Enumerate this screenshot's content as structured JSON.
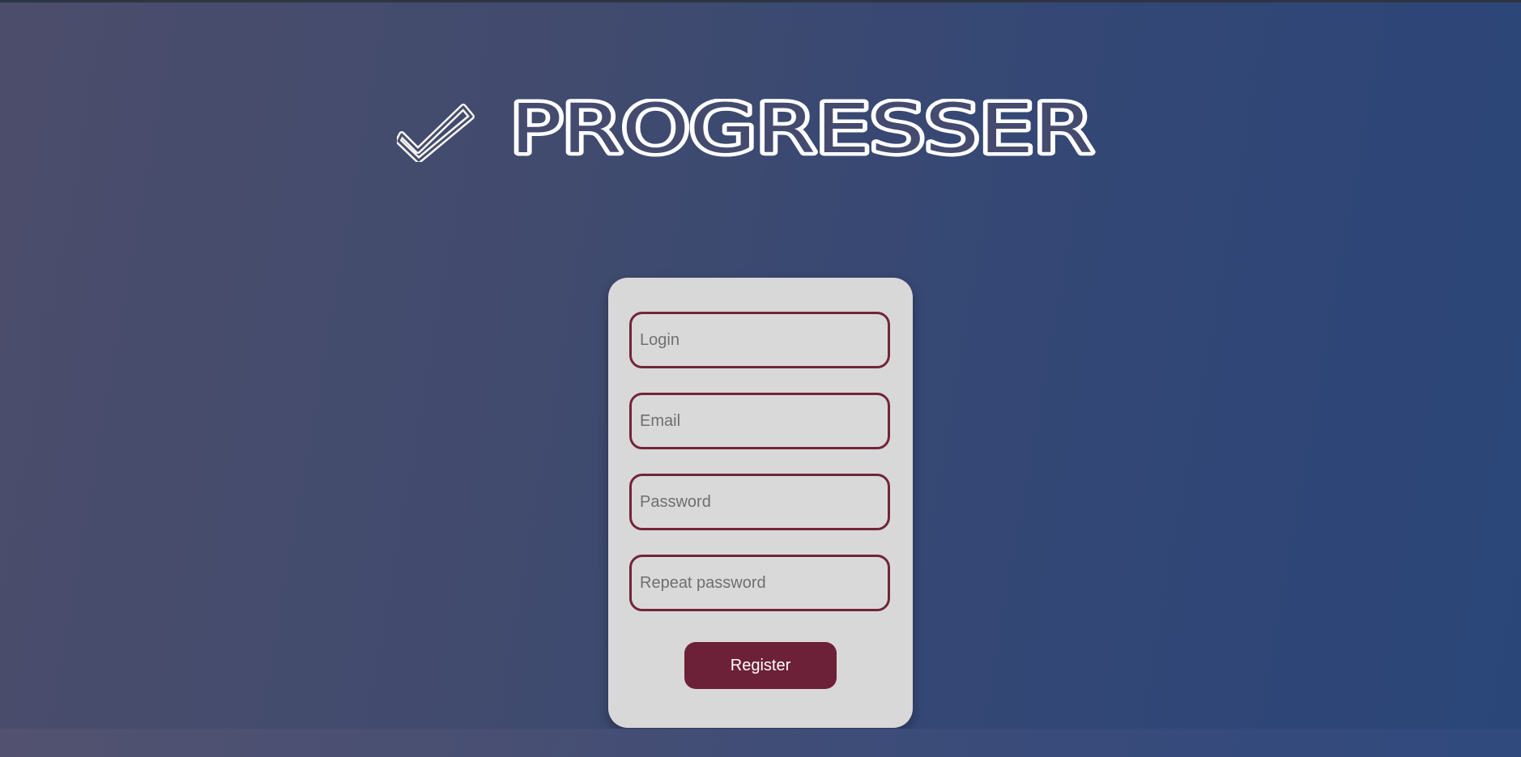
{
  "brand": {
    "title": "PROGRESSER",
    "icon": "check-icon"
  },
  "form": {
    "login_placeholder": "Login",
    "email_placeholder": "Email",
    "password_placeholder": "Password",
    "repeat_password_placeholder": "Repeat password",
    "register_label": "Register"
  },
  "colors": {
    "accent": "#6d2138",
    "field_border": "#722539",
    "card_bg": "#d9d8d9"
  }
}
